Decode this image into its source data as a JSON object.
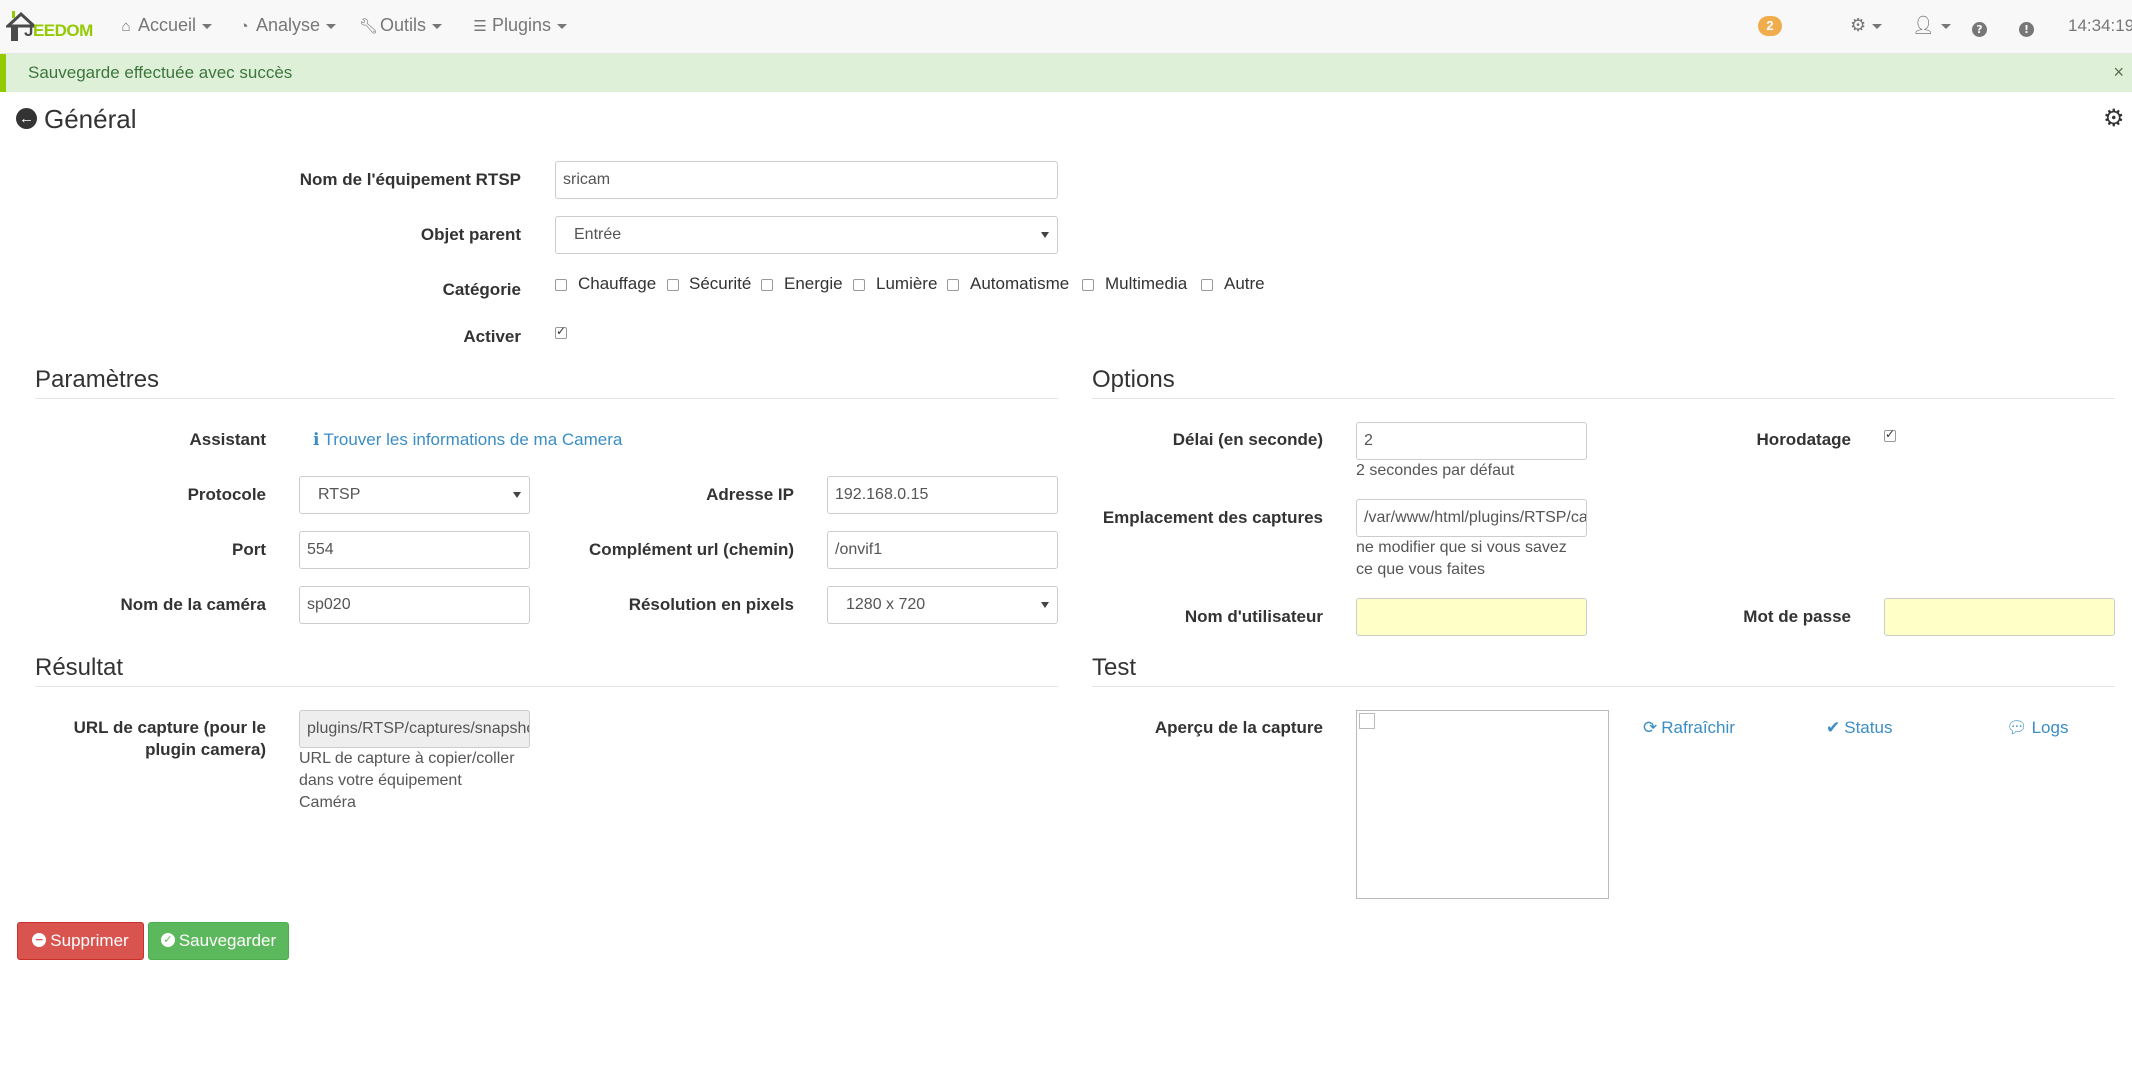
{
  "navbar": {
    "logo_text_a": "J",
    "logo_text_b": "EEDOM",
    "menu": [
      {
        "label": "Accueil",
        "icon": "home-icon"
      },
      {
        "label": "Analyse",
        "icon": "dashboard-icon"
      },
      {
        "label": "Outils",
        "icon": "wrench-icon"
      },
      {
        "label": "Plugins",
        "icon": "tasks-icon"
      }
    ],
    "notification_count": "2",
    "clock": "14:34:19"
  },
  "alert": {
    "message": "Sauvegarde effectuée avec succès",
    "close": "×"
  },
  "page": {
    "title": "Général"
  },
  "general": {
    "name_label": "Nom de l'équipement RTSP",
    "name_value": "sricam",
    "parent_label": "Objet parent",
    "parent_value": "Entrée",
    "category_label": "Catégorie",
    "categories": [
      {
        "label": "Chauffage",
        "checked": false
      },
      {
        "label": "Sécurité",
        "checked": false
      },
      {
        "label": "Energie",
        "checked": false
      },
      {
        "label": "Lumière",
        "checked": false
      },
      {
        "label": "Automatisme",
        "checked": false
      },
      {
        "label": "Multimedia",
        "checked": false
      },
      {
        "label": "Autre",
        "checked": false
      }
    ],
    "activate_label": "Activer",
    "activate_checked": true
  },
  "parametres": {
    "title": "Paramètres",
    "assistant_label": "Assistant",
    "assistant_link": "Trouver les informations de ma Camera",
    "protocole_label": "Protocole",
    "protocole_value": "RTSP",
    "ip_label": "Adresse IP",
    "ip_value": "192.168.0.15",
    "port_label": "Port",
    "port_value": "554",
    "url_label": "Complément url (chemin)",
    "url_value": "/onvif1",
    "camera_name_label": "Nom de la caméra",
    "camera_name_value": "sp020",
    "resolution_label": "Résolution en pixels",
    "resolution_value": "1280 x 720"
  },
  "options": {
    "title": "Options",
    "delay_label": "Délai (en seconde)",
    "delay_value": "2",
    "delay_help": "2 secondes par défaut",
    "timestamp_label": "Horodatage",
    "timestamp_checked": true,
    "location_label": "Emplacement des captures",
    "location_value": "/var/www/html/plugins/RTSP/ca",
    "location_help_1": "ne modifier que si vous savez",
    "location_help_2": "ce que vous faites",
    "username_label": "Nom d'utilisateur",
    "username_value": "",
    "password_label": "Mot de passe",
    "password_value": ""
  },
  "resultat": {
    "title": "Résultat",
    "capture_label_1": "URL de capture (pour le",
    "capture_label_2": "plugin camera)",
    "capture_value": "plugins/RTSP/captures/snapsho",
    "capture_help_1": "URL de capture à copier/coller",
    "capture_help_2": "dans votre équipement",
    "capture_help_3": "Caméra"
  },
  "test": {
    "title": "Test",
    "preview_label": "Aperçu de la capture",
    "refresh": "Rafraîchir",
    "status": "Status",
    "logs": "Logs"
  },
  "actions": {
    "delete": "Supprimer",
    "save": "Sauvegarder"
  },
  "colors": {
    "brand": "#94ca02",
    "danger": "#d9534f",
    "success": "#5cb85c",
    "link": "#3a8ec3",
    "badge": "#f0ad4e"
  }
}
